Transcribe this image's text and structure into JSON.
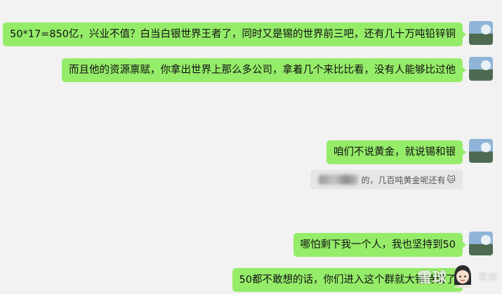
{
  "messages": [
    {
      "text": "50*17=850亿，兴业不值？白当白银世界王者了，同时又是锡的世界前三吧，还有几十万吨铅锌铜"
    },
    {
      "text": "而且他的资源禀赋，你拿出世界上那么多公司，拿着几个来比比看，没有人能够比过他"
    },
    {
      "text": "咱们不说黄金，就说锡和银"
    },
    {
      "text": "哪怕剩下我一个人，我也坚持到50"
    },
    {
      "text": "50都不敢想的话，你们进入这个群就大错特错了"
    }
  ],
  "quote": {
    "text": "的，几百吨黄金呢还有",
    "emoji": "🐱"
  },
  "watermark": {
    "logo_text": "雪球",
    "user_text": "老衲"
  },
  "colors": {
    "bubble": "#95ec69",
    "background": "#f2f2f2",
    "quote_bg": "#e6e6e6"
  }
}
